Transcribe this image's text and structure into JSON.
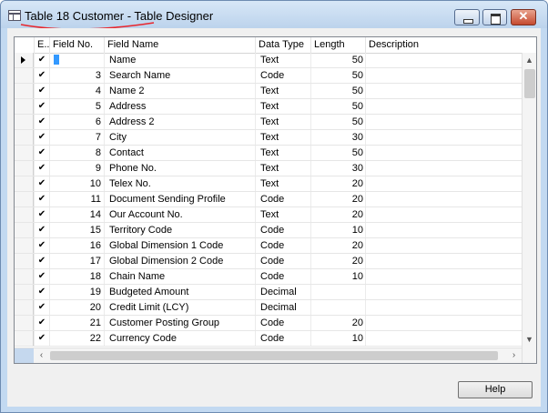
{
  "window": {
    "title": "Table 18 Customer - Table Designer",
    "close_glyph": "✕"
  },
  "grid": {
    "headers": {
      "enabled": "E..",
      "field_no": "Field No.",
      "field_name": "Field Name",
      "data_type": "Data Type",
      "length": "Length",
      "description": "Description"
    },
    "current_row_edit": "",
    "rows": [
      {
        "enabled": "✔",
        "field_no": "",
        "field_name": "Name",
        "data_type": "Text",
        "length": "50",
        "description": ""
      },
      {
        "enabled": "✔",
        "field_no": "3",
        "field_name": "Search Name",
        "data_type": "Code",
        "length": "50",
        "description": ""
      },
      {
        "enabled": "✔",
        "field_no": "4",
        "field_name": "Name 2",
        "data_type": "Text",
        "length": "50",
        "description": ""
      },
      {
        "enabled": "✔",
        "field_no": "5",
        "field_name": "Address",
        "data_type": "Text",
        "length": "50",
        "description": ""
      },
      {
        "enabled": "✔",
        "field_no": "6",
        "field_name": "Address 2",
        "data_type": "Text",
        "length": "50",
        "description": ""
      },
      {
        "enabled": "✔",
        "field_no": "7",
        "field_name": "City",
        "data_type": "Text",
        "length": "30",
        "description": ""
      },
      {
        "enabled": "✔",
        "field_no": "8",
        "field_name": "Contact",
        "data_type": "Text",
        "length": "50",
        "description": ""
      },
      {
        "enabled": "✔",
        "field_no": "9",
        "field_name": "Phone No.",
        "data_type": "Text",
        "length": "30",
        "description": ""
      },
      {
        "enabled": "✔",
        "field_no": "10",
        "field_name": "Telex No.",
        "data_type": "Text",
        "length": "20",
        "description": ""
      },
      {
        "enabled": "✔",
        "field_no": "11",
        "field_name": "Document Sending Profile",
        "data_type": "Code",
        "length": "20",
        "description": ""
      },
      {
        "enabled": "✔",
        "field_no": "14",
        "field_name": "Our Account No.",
        "data_type": "Text",
        "length": "20",
        "description": ""
      },
      {
        "enabled": "✔",
        "field_no": "15",
        "field_name": "Territory Code",
        "data_type": "Code",
        "length": "10",
        "description": ""
      },
      {
        "enabled": "✔",
        "field_no": "16",
        "field_name": "Global Dimension 1 Code",
        "data_type": "Code",
        "length": "20",
        "description": ""
      },
      {
        "enabled": "✔",
        "field_no": "17",
        "field_name": "Global Dimension 2 Code",
        "data_type": "Code",
        "length": "20",
        "description": ""
      },
      {
        "enabled": "✔",
        "field_no": "18",
        "field_name": "Chain Name",
        "data_type": "Code",
        "length": "10",
        "description": ""
      },
      {
        "enabled": "✔",
        "field_no": "19",
        "field_name": "Budgeted Amount",
        "data_type": "Decimal",
        "length": "",
        "description": ""
      },
      {
        "enabled": "✔",
        "field_no": "20",
        "field_name": "Credit Limit (LCY)",
        "data_type": "Decimal",
        "length": "",
        "description": ""
      },
      {
        "enabled": "✔",
        "field_no": "21",
        "field_name": "Customer Posting Group",
        "data_type": "Code",
        "length": "20",
        "description": ""
      },
      {
        "enabled": "✔",
        "field_no": "22",
        "field_name": "Currency Code",
        "data_type": "Code",
        "length": "10",
        "description": ""
      }
    ]
  },
  "scrollbars": {
    "up_glyph": "▲",
    "down_glyph": "▼",
    "left_glyph": "‹",
    "right_glyph": "›"
  },
  "footer": {
    "help_label": "Help"
  },
  "colors": {
    "title_bar": "#c2d9f1",
    "annotation_underline": "#e8262d",
    "selection": "#3399ff"
  }
}
